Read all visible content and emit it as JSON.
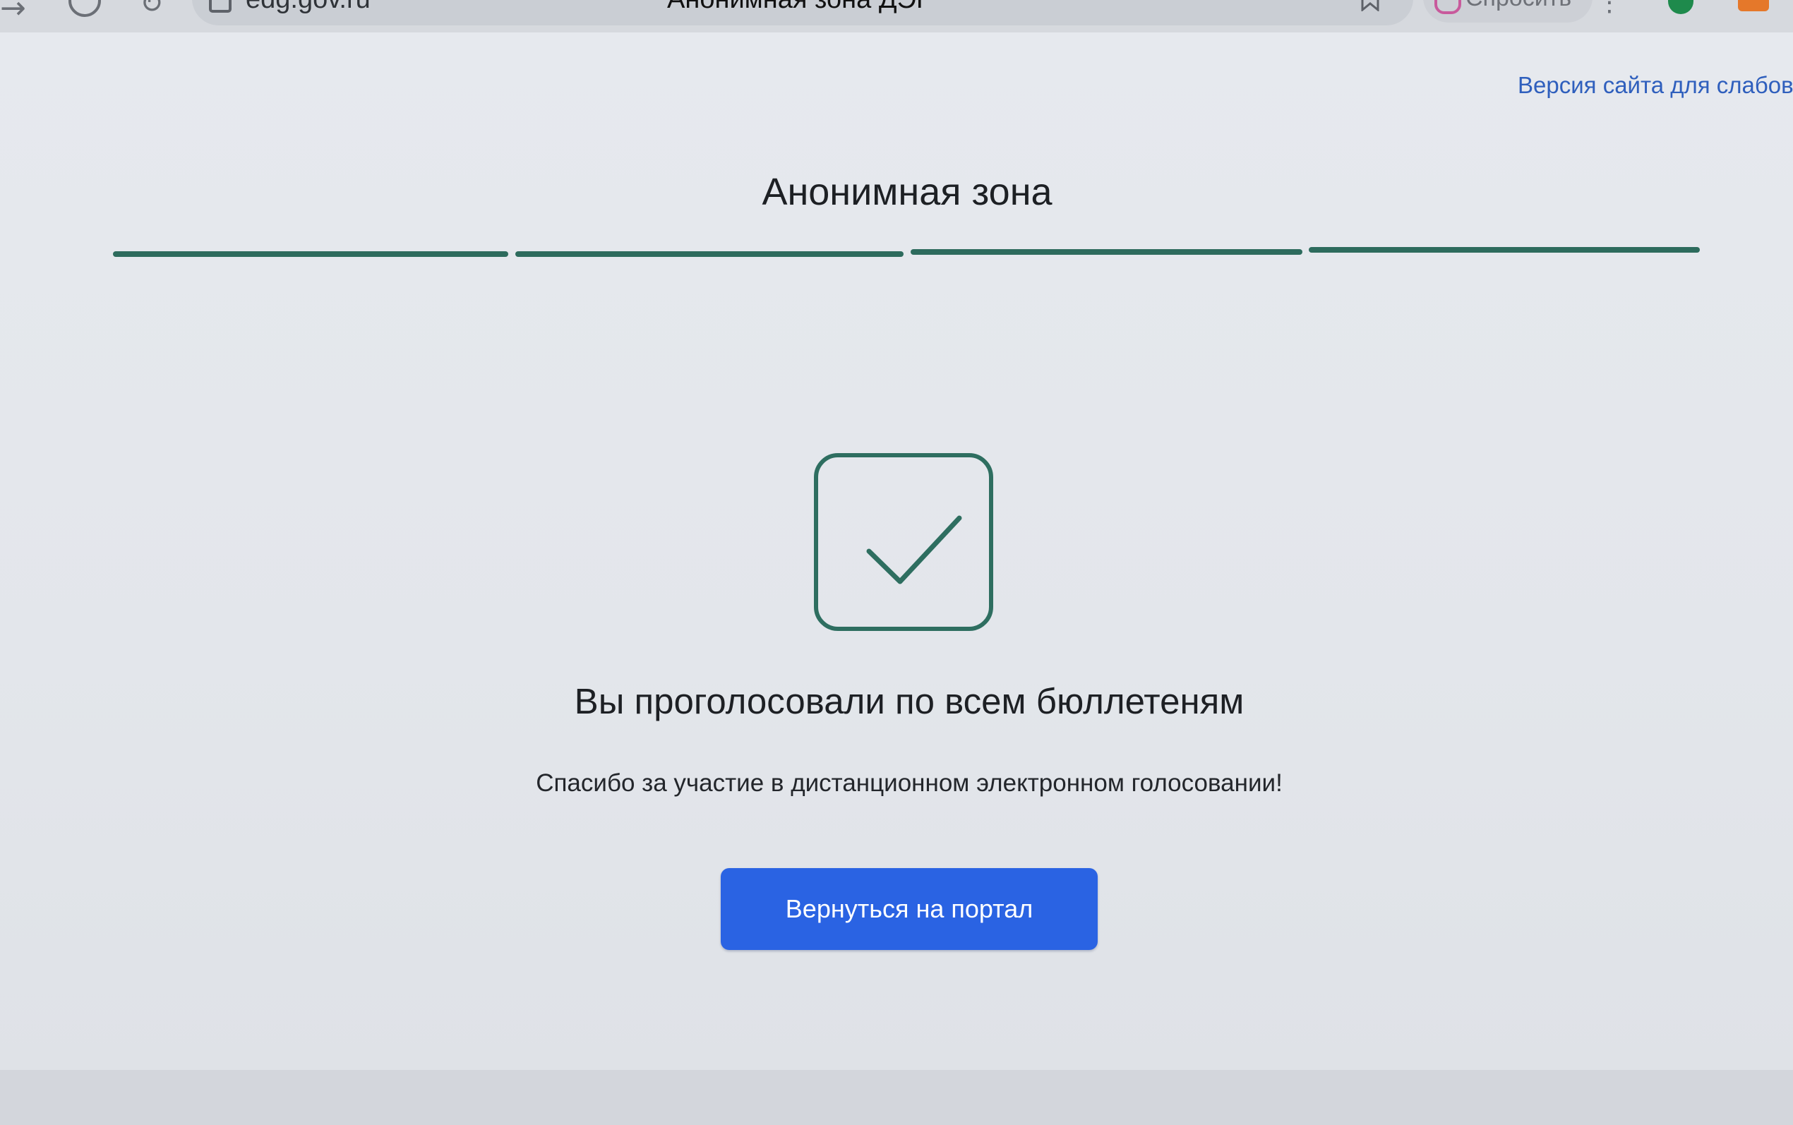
{
  "browser": {
    "forward_icon": "arrow-right-icon",
    "reload_icon": "reload-icon",
    "url": "edg.gov.ru",
    "tab_title": "Анонимная зона ДЭГ",
    "ask_label": "Спросить",
    "menu_glyph": "⋮"
  },
  "header": {
    "accessibility_link": "Версия сайта для слабовидящих"
  },
  "page": {
    "title": "Анонимная зона",
    "steps_total": 4,
    "steps_completed": 4,
    "accent_color": "#2d6b5d"
  },
  "result": {
    "icon": "checkmark-icon",
    "title": "Вы проголосовали по всем бюллетеням",
    "subtitle": "Спасибо за участие в дистанционном электронном голосовании!",
    "button_label": "Вернуться на портал",
    "button_color": "#2a63e3"
  }
}
